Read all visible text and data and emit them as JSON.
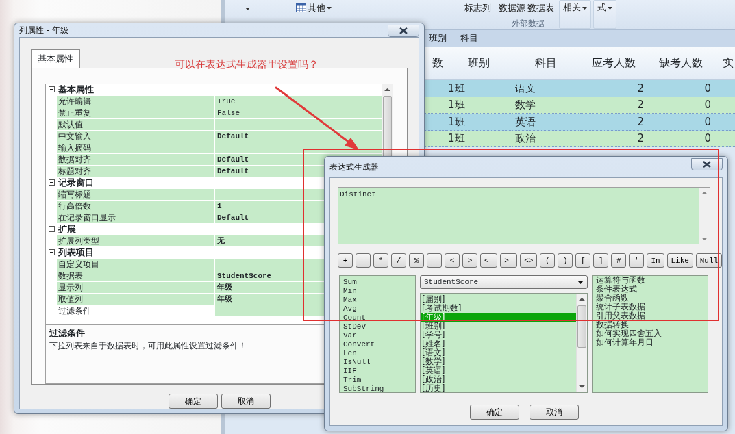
{
  "background_app": {
    "ribbon": {
      "items": [
        {
          "label": "其他",
          "kind": "table-menu"
        },
        {
          "label": "标志列",
          "kind": "plain"
        },
        {
          "label": "数据源",
          "kind": "plain"
        },
        {
          "label": "数据表",
          "kind": "plain"
        },
        {
          "label": "相关",
          "kind": "menu"
        },
        {
          "label": "式",
          "kind": "menu"
        }
      ],
      "group_labels": [
        "外部数据"
      ]
    },
    "group_by": [
      "班别",
      "科目"
    ],
    "table": {
      "columns": [
        "数",
        "班别",
        "科目",
        "应考人数",
        "缺考人数",
        "实"
      ],
      "rows": [
        {
          "class": "1班",
          "subject": "语文",
          "expected": "2",
          "absent": "0"
        },
        {
          "class": "1班",
          "subject": "数学",
          "expected": "2",
          "absent": "0"
        },
        {
          "class": "1班",
          "subject": "英语",
          "expected": "2",
          "absent": "0"
        },
        {
          "class": "1班",
          "subject": "政治",
          "expected": "2",
          "absent": "0"
        }
      ]
    }
  },
  "column_dialog": {
    "title": "列属性 - 年级",
    "tabs": [
      {
        "label": "基本属性",
        "selected": true
      }
    ],
    "property_groups": [
      {
        "name": "基本属性",
        "expanded": true,
        "properties": [
          {
            "name": "允许编辑",
            "value": "True",
            "modified": false,
            "selected": false
          },
          {
            "name": "禁止重复",
            "value": "False",
            "modified": false,
            "selected": false
          },
          {
            "name": "默认值",
            "selected": false
          },
          {
            "name": "中文输入",
            "value": "Default",
            "modified": true,
            "selected": false
          },
          {
            "name": "输入摘码",
            "selected": false
          },
          {
            "name": "数据对齐",
            "value": "Default",
            "modified": true,
            "selected": false
          },
          {
            "name": "标题对齐",
            "value": "Default",
            "modified": true,
            "selected": false
          }
        ]
      },
      {
        "name": "记录窗口",
        "expanded": true,
        "properties": [
          {
            "name": "缩写标题",
            "selected": false
          },
          {
            "name": "行高倍数",
            "value": "1",
            "modified": true,
            "selected": false
          },
          {
            "name": "在记录窗口显示",
            "value": "Default",
            "modified": true,
            "selected": false
          }
        ]
      },
      {
        "name": "扩展",
        "expanded": true,
        "properties": [
          {
            "name": "扩展列类型",
            "value": "无",
            "modified": true,
            "selected": false
          }
        ]
      },
      {
        "name": "列表项目",
        "expanded": true,
        "properties": [
          {
            "name": "自定义项目",
            "selected": false
          },
          {
            "name": "数据表",
            "value": "StudentScore",
            "modified": true,
            "selected": false
          },
          {
            "name": "显示列",
            "value": "年级",
            "modified": true,
            "selected": false
          },
          {
            "name": "取值列",
            "value": "年级",
            "modified": true,
            "selected": false
          },
          {
            "name": "过滤条件",
            "selected": true
          }
        ]
      }
    ],
    "description": {
      "title": "过滤条件",
      "text": "下拉列表来自于数据表时，可用此属性设置过滤条件！"
    },
    "buttons": [
      "确定",
      "取消"
    ]
  },
  "annotation": {
    "text": "可以在表达式生成器里设置吗？"
  },
  "expression_dialog": {
    "title": "表达式生成器",
    "expression": "Distinct",
    "operators": [
      "+",
      "-",
      "*",
      "/",
      "%",
      "=",
      "<",
      ">",
      "<=",
      ">=",
      "<>",
      "(",
      ")",
      "[",
      "]",
      "#",
      "'",
      "In",
      "Like",
      "Null"
    ],
    "functions": [
      "Sum",
      "Min",
      "Max",
      "Avg",
      "Count",
      "StDev",
      "Var",
      "Convert",
      "Len",
      "IsNull",
      "IIF",
      "Trim",
      "SubString"
    ],
    "table_select": "StudentScore",
    "fields": [
      {
        "label": "[届别]",
        "selected": false
      },
      {
        "label": "[考试期数]",
        "selected": false
      },
      {
        "label": "[年级]",
        "selected": true
      },
      {
        "label": "[班别]",
        "selected": false
      },
      {
        "label": "[学号]",
        "selected": false
      },
      {
        "label": "[姓名]",
        "selected": false
      },
      {
        "label": "[语文]",
        "selected": false
      },
      {
        "label": "[数学]",
        "selected": false
      },
      {
        "label": "[英语]",
        "selected": false
      },
      {
        "label": "[政治]",
        "selected": false
      },
      {
        "label": "[历史]",
        "selected": false
      }
    ],
    "categories": [
      "运算符与函数",
      "条件表达式",
      "聚合函数",
      "统计子表数据",
      "引用父表数据",
      "数据转换",
      "如何实现四舍五入",
      "如何计算年月日"
    ],
    "buttons": [
      "确定",
      "取消"
    ]
  }
}
